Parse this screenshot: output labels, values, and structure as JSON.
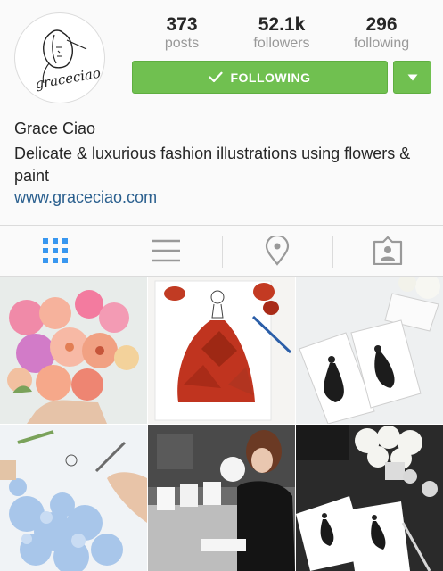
{
  "profile": {
    "avatar_signature": "graceciao",
    "name": "Grace Ciao",
    "bio": "Delicate & luxurious fashion illustrations using flowers & paint",
    "website": "www.graceciao.com"
  },
  "stats": [
    {
      "value": "373",
      "label": "posts"
    },
    {
      "value": "52.1k",
      "label": "followers"
    },
    {
      "value": "296",
      "label": "following"
    }
  ],
  "actions": {
    "follow_label": "FOLLOWING",
    "follow_icon": "check-icon",
    "dropdown_icon": "caret-down-icon"
  },
  "tabs": [
    {
      "icon": "grid-icon",
      "active": true
    },
    {
      "icon": "list-icon",
      "active": false
    },
    {
      "icon": "location-pin-icon",
      "active": false
    },
    {
      "icon": "tagged-user-icon",
      "active": false
    }
  ],
  "colors": {
    "follow_green": "#70c050",
    "active_tab_blue": "#3897f0",
    "link_blue": "#2a5f8e",
    "muted_gray": "#999999"
  },
  "posts": [
    {
      "subject": "pink and peach flower bouquet held in hand"
    },
    {
      "subject": "red leaf gown fashion illustration"
    },
    {
      "subject": "Chanel fashion illustration cards"
    },
    {
      "subject": "blue hydrangea dress illustration being painted"
    },
    {
      "subject": "artist drawing at event"
    },
    {
      "subject": "Chanel fashion sketches with white roses"
    }
  ]
}
